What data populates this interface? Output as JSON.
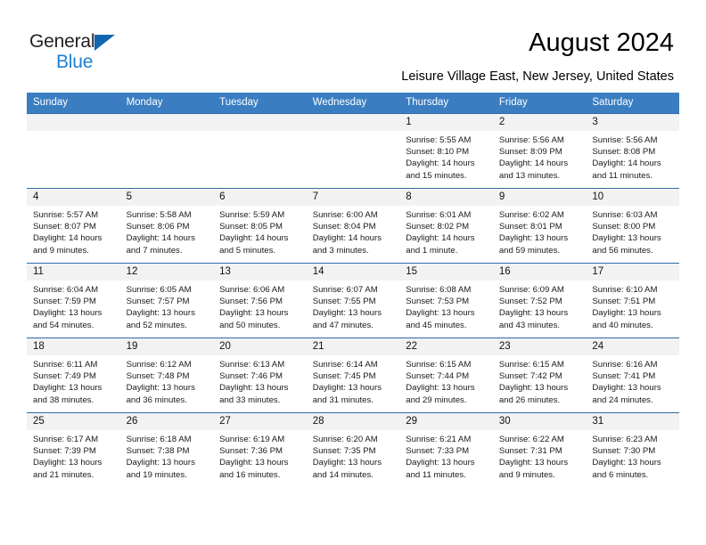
{
  "brand": {
    "word1": "General",
    "word2": "Blue",
    "triangle_color": "#1266b0",
    "blue_color": "#1b7fd4"
  },
  "header": {
    "title": "August 2024",
    "subtitle": "Leisure Village East, New Jersey, United States"
  },
  "theme": {
    "header_bg": "#3a7ec1",
    "grid_line": "#2d6ca8",
    "daynum_bg": "#f2f2f2"
  },
  "weekday_headers": [
    "Sunday",
    "Monday",
    "Tuesday",
    "Wednesday",
    "Thursday",
    "Friday",
    "Saturday"
  ],
  "weeks": [
    [
      {
        "day": "",
        "blank": true,
        "sunrise": "",
        "sunset": "",
        "daylight1": "",
        "daylight2": ""
      },
      {
        "day": "",
        "blank": true,
        "sunrise": "",
        "sunset": "",
        "daylight1": "",
        "daylight2": ""
      },
      {
        "day": "",
        "blank": true,
        "sunrise": "",
        "sunset": "",
        "daylight1": "",
        "daylight2": ""
      },
      {
        "day": "",
        "blank": true,
        "sunrise": "",
        "sunset": "",
        "daylight1": "",
        "daylight2": ""
      },
      {
        "day": "1",
        "blank": false,
        "sunrise": "Sunrise: 5:55 AM",
        "sunset": "Sunset: 8:10 PM",
        "daylight1": "Daylight: 14 hours",
        "daylight2": "and 15 minutes."
      },
      {
        "day": "2",
        "blank": false,
        "sunrise": "Sunrise: 5:56 AM",
        "sunset": "Sunset: 8:09 PM",
        "daylight1": "Daylight: 14 hours",
        "daylight2": "and 13 minutes."
      },
      {
        "day": "3",
        "blank": false,
        "sunrise": "Sunrise: 5:56 AM",
        "sunset": "Sunset: 8:08 PM",
        "daylight1": "Daylight: 14 hours",
        "daylight2": "and 11 minutes."
      }
    ],
    [
      {
        "day": "4",
        "blank": false,
        "sunrise": "Sunrise: 5:57 AM",
        "sunset": "Sunset: 8:07 PM",
        "daylight1": "Daylight: 14 hours",
        "daylight2": "and 9 minutes."
      },
      {
        "day": "5",
        "blank": false,
        "sunrise": "Sunrise: 5:58 AM",
        "sunset": "Sunset: 8:06 PM",
        "daylight1": "Daylight: 14 hours",
        "daylight2": "and 7 minutes."
      },
      {
        "day": "6",
        "blank": false,
        "sunrise": "Sunrise: 5:59 AM",
        "sunset": "Sunset: 8:05 PM",
        "daylight1": "Daylight: 14 hours",
        "daylight2": "and 5 minutes."
      },
      {
        "day": "7",
        "blank": false,
        "sunrise": "Sunrise: 6:00 AM",
        "sunset": "Sunset: 8:04 PM",
        "daylight1": "Daylight: 14 hours",
        "daylight2": "and 3 minutes."
      },
      {
        "day": "8",
        "blank": false,
        "sunrise": "Sunrise: 6:01 AM",
        "sunset": "Sunset: 8:02 PM",
        "daylight1": "Daylight: 14 hours",
        "daylight2": "and 1 minute."
      },
      {
        "day": "9",
        "blank": false,
        "sunrise": "Sunrise: 6:02 AM",
        "sunset": "Sunset: 8:01 PM",
        "daylight1": "Daylight: 13 hours",
        "daylight2": "and 59 minutes."
      },
      {
        "day": "10",
        "blank": false,
        "sunrise": "Sunrise: 6:03 AM",
        "sunset": "Sunset: 8:00 PM",
        "daylight1": "Daylight: 13 hours",
        "daylight2": "and 56 minutes."
      }
    ],
    [
      {
        "day": "11",
        "blank": false,
        "sunrise": "Sunrise: 6:04 AM",
        "sunset": "Sunset: 7:59 PM",
        "daylight1": "Daylight: 13 hours",
        "daylight2": "and 54 minutes."
      },
      {
        "day": "12",
        "blank": false,
        "sunrise": "Sunrise: 6:05 AM",
        "sunset": "Sunset: 7:57 PM",
        "daylight1": "Daylight: 13 hours",
        "daylight2": "and 52 minutes."
      },
      {
        "day": "13",
        "blank": false,
        "sunrise": "Sunrise: 6:06 AM",
        "sunset": "Sunset: 7:56 PM",
        "daylight1": "Daylight: 13 hours",
        "daylight2": "and 50 minutes."
      },
      {
        "day": "14",
        "blank": false,
        "sunrise": "Sunrise: 6:07 AM",
        "sunset": "Sunset: 7:55 PM",
        "daylight1": "Daylight: 13 hours",
        "daylight2": "and 47 minutes."
      },
      {
        "day": "15",
        "blank": false,
        "sunrise": "Sunrise: 6:08 AM",
        "sunset": "Sunset: 7:53 PM",
        "daylight1": "Daylight: 13 hours",
        "daylight2": "and 45 minutes."
      },
      {
        "day": "16",
        "blank": false,
        "sunrise": "Sunrise: 6:09 AM",
        "sunset": "Sunset: 7:52 PM",
        "daylight1": "Daylight: 13 hours",
        "daylight2": "and 43 minutes."
      },
      {
        "day": "17",
        "blank": false,
        "sunrise": "Sunrise: 6:10 AM",
        "sunset": "Sunset: 7:51 PM",
        "daylight1": "Daylight: 13 hours",
        "daylight2": "and 40 minutes."
      }
    ],
    [
      {
        "day": "18",
        "blank": false,
        "sunrise": "Sunrise: 6:11 AM",
        "sunset": "Sunset: 7:49 PM",
        "daylight1": "Daylight: 13 hours",
        "daylight2": "and 38 minutes."
      },
      {
        "day": "19",
        "blank": false,
        "sunrise": "Sunrise: 6:12 AM",
        "sunset": "Sunset: 7:48 PM",
        "daylight1": "Daylight: 13 hours",
        "daylight2": "and 36 minutes."
      },
      {
        "day": "20",
        "blank": false,
        "sunrise": "Sunrise: 6:13 AM",
        "sunset": "Sunset: 7:46 PM",
        "daylight1": "Daylight: 13 hours",
        "daylight2": "and 33 minutes."
      },
      {
        "day": "21",
        "blank": false,
        "sunrise": "Sunrise: 6:14 AM",
        "sunset": "Sunset: 7:45 PM",
        "daylight1": "Daylight: 13 hours",
        "daylight2": "and 31 minutes."
      },
      {
        "day": "22",
        "blank": false,
        "sunrise": "Sunrise: 6:15 AM",
        "sunset": "Sunset: 7:44 PM",
        "daylight1": "Daylight: 13 hours",
        "daylight2": "and 29 minutes."
      },
      {
        "day": "23",
        "blank": false,
        "sunrise": "Sunrise: 6:15 AM",
        "sunset": "Sunset: 7:42 PM",
        "daylight1": "Daylight: 13 hours",
        "daylight2": "and 26 minutes."
      },
      {
        "day": "24",
        "blank": false,
        "sunrise": "Sunrise: 6:16 AM",
        "sunset": "Sunset: 7:41 PM",
        "daylight1": "Daylight: 13 hours",
        "daylight2": "and 24 minutes."
      }
    ],
    [
      {
        "day": "25",
        "blank": false,
        "sunrise": "Sunrise: 6:17 AM",
        "sunset": "Sunset: 7:39 PM",
        "daylight1": "Daylight: 13 hours",
        "daylight2": "and 21 minutes."
      },
      {
        "day": "26",
        "blank": false,
        "sunrise": "Sunrise: 6:18 AM",
        "sunset": "Sunset: 7:38 PM",
        "daylight1": "Daylight: 13 hours",
        "daylight2": "and 19 minutes."
      },
      {
        "day": "27",
        "blank": false,
        "sunrise": "Sunrise: 6:19 AM",
        "sunset": "Sunset: 7:36 PM",
        "daylight1": "Daylight: 13 hours",
        "daylight2": "and 16 minutes."
      },
      {
        "day": "28",
        "blank": false,
        "sunrise": "Sunrise: 6:20 AM",
        "sunset": "Sunset: 7:35 PM",
        "daylight1": "Daylight: 13 hours",
        "daylight2": "and 14 minutes."
      },
      {
        "day": "29",
        "blank": false,
        "sunrise": "Sunrise: 6:21 AM",
        "sunset": "Sunset: 7:33 PM",
        "daylight1": "Daylight: 13 hours",
        "daylight2": "and 11 minutes."
      },
      {
        "day": "30",
        "blank": false,
        "sunrise": "Sunrise: 6:22 AM",
        "sunset": "Sunset: 7:31 PM",
        "daylight1": "Daylight: 13 hours",
        "daylight2": "and 9 minutes."
      },
      {
        "day": "31",
        "blank": false,
        "sunrise": "Sunrise: 6:23 AM",
        "sunset": "Sunset: 7:30 PM",
        "daylight1": "Daylight: 13 hours",
        "daylight2": "and 6 minutes."
      }
    ]
  ]
}
